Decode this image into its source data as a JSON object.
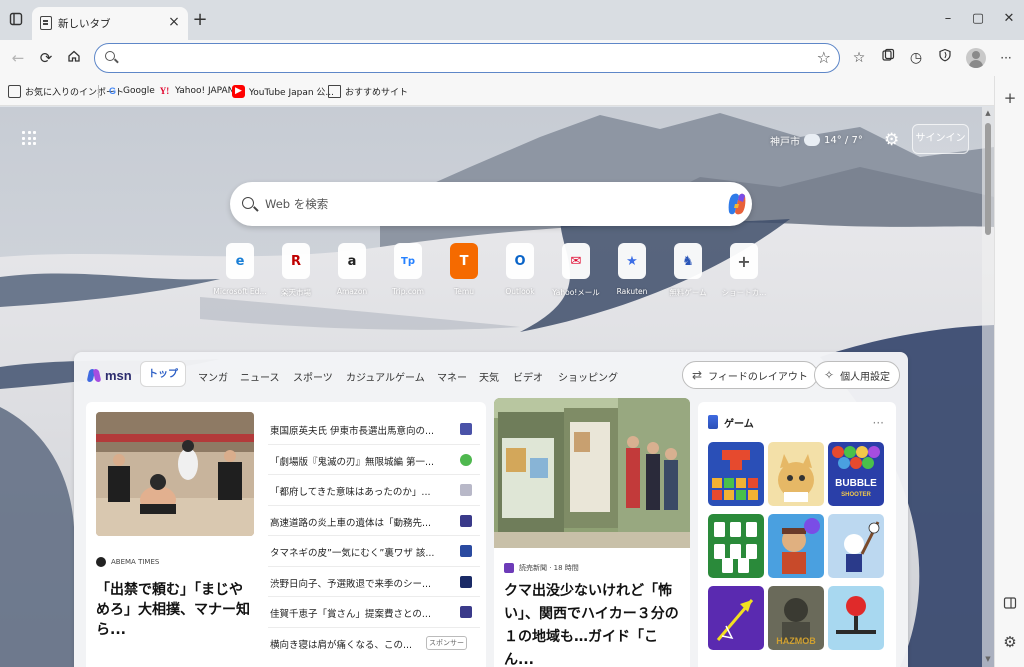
{
  "window": {
    "tab_title": "新しいタブ",
    "tab_close": "×",
    "new_tab": "+",
    "minimize": "–",
    "maximize": "▢",
    "close": "✕"
  },
  "toolbar": {
    "address_value": "",
    "address_placeholder": "",
    "icons": [
      "back-icon",
      "refresh-icon",
      "home-icon",
      "favorite-star-icon",
      "favorites-icon",
      "collections-icon",
      "history-icon",
      "browser-essentials-icon",
      "profile-avatar",
      "more-icon"
    ],
    "more": "···"
  },
  "favorites": [
    {
      "label": "お気に入りのインポート",
      "icon": "import-icon"
    },
    {
      "label": "Google",
      "icon": "google-icon",
      "glyph": "G"
    },
    {
      "label": "Yahoo! JAPAN",
      "icon": "yahoo-icon",
      "glyph": "Y!"
    },
    {
      "label": "YouTube Japan 公...",
      "icon": "youtube-icon",
      "glyph": "▶"
    },
    {
      "label": "おすすめサイト",
      "icon": "page-icon"
    }
  ],
  "sidepanel": {
    "add": "+",
    "icons": [
      "add-icon",
      "split-screen-icon",
      "settings-icon"
    ]
  },
  "newtab": {
    "weather": {
      "city": "神戸市",
      "temp": "14° / 7°"
    },
    "signin": "サインイン",
    "search_placeholder": "Web を検索",
    "quick_links": [
      {
        "label": "Microsoft Ed...",
        "glyph": "e",
        "color": "#1a7fd6"
      },
      {
        "label": "楽天市場",
        "glyph": "R",
        "color": "#bf0000"
      },
      {
        "label": "Amazon",
        "glyph": "a",
        "color": "#222222"
      },
      {
        "label": "Trip.com",
        "glyph": "Tp",
        "color": "#2681ff"
      },
      {
        "label": "Temu",
        "glyph": "T",
        "color": "#f56a00"
      },
      {
        "label": "Outlook",
        "glyph": "O",
        "color": "#0a64c8"
      },
      {
        "label": "Yahoo!メール",
        "glyph": "✉",
        "color": "#e0002a"
      },
      {
        "label": "Rakuten",
        "glyph": "★",
        "color": "#3c6ee6"
      },
      {
        "label": "無料ゲーム",
        "glyph": "♞",
        "color": "#2a55b8"
      },
      {
        "label": "ショートカ...",
        "glyph": "+",
        "color": "#555555"
      }
    ]
  },
  "feed": {
    "logo": "msn",
    "tabs": [
      "トップ",
      "マンガ",
      "ニュース",
      "スポーツ",
      "カジュアルゲーム",
      "マネー",
      "天気",
      "ビデオ",
      "ショッピング"
    ],
    "layout_button": "フィードのレイアウト",
    "personalize_button": "個人用設定",
    "card1": {
      "source": "ABEMA TIMES",
      "title": "「出禁で頼む」「まじやめろ」大相撲、マナー知ら..."
    },
    "headlines": [
      {
        "text": "東国原英夫氏 伊東市長選出馬意向の...",
        "color": "#4a52a8"
      },
      {
        "text": "「劇場版『鬼滅の刃』無限城編 第一...",
        "color": "#4fb84f"
      },
      {
        "text": "「都府してきた意味はあったのか」...",
        "color": "#b8b8c8"
      },
      {
        "text": "高速道路の炎上車の遺体は「動務先...",
        "color": "#3a3a8a"
      },
      {
        "text": "タマネギの皮”一気にむく”裏ワザ 該...",
        "color": "#2a4aa0"
      },
      {
        "text": "渋野日向子、予選敗退で来季のシー...",
        "color": "#1a2a66"
      },
      {
        "text": "佳賀千恵子「賞さん」提案費さとの...",
        "color": "#3a3a8a"
      },
      {
        "text": "横向き寝は肩が痛くなる、この...",
        "sponsor": "スポンサー"
      }
    ],
    "card2": {
      "source": "読売新聞 · 18 時間",
      "title": "クマ出没少ないけれど「怖い」、関西でハイカー３分の１の地域も…ガイド「こん..."
    },
    "games": {
      "title": "ゲーム",
      "more": "···",
      "items": [
        {
          "name": "block-puzzle-game",
          "colors": [
            "#2a4fb7",
            "#e64a2e"
          ]
        },
        {
          "name": "cat-game",
          "colors": [
            "#f3e0a8",
            "#c9a45a"
          ]
        },
        {
          "name": "bubble-shooter-game",
          "colors": [
            "#2a3fa8",
            "#f2c84a"
          ],
          "label": "BUBBLE SHOOTER"
        },
        {
          "name": "solitaire-game",
          "colors": [
            "#2a8a3a",
            "#ffffff"
          ]
        },
        {
          "name": "cartoon-hero-game",
          "colors": [
            "#4aa0e0",
            "#e0b060"
          ]
        },
        {
          "name": "bat-cartoon-game",
          "colors": [
            "#bcd8f0",
            "#2a3a8a"
          ]
        },
        {
          "name": "arrow-game",
          "colors": [
            "#5a2ab0",
            "#f2e020"
          ]
        },
        {
          "name": "hazmob-game",
          "colors": [
            "#6a6a5a",
            "#d0a030"
          ],
          "label": "HAZMOB"
        },
        {
          "name": "ball-drop-game",
          "colors": [
            "#a8d8f0",
            "#e02a2a"
          ]
        }
      ]
    }
  }
}
